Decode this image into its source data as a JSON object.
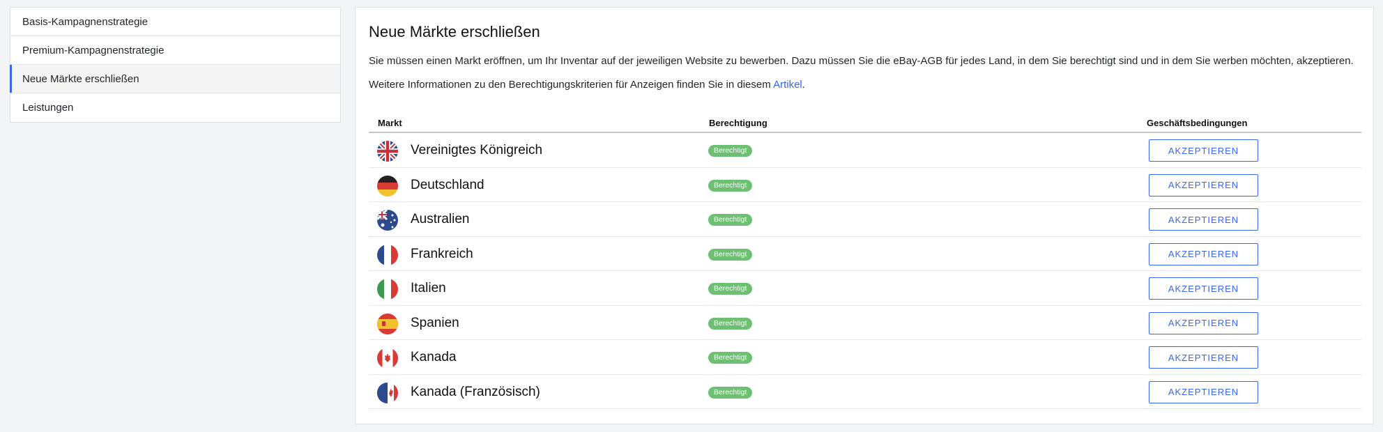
{
  "sidebar": {
    "items": [
      {
        "label": "Basis-Kampagnenstrategie"
      },
      {
        "label": "Premium-Kampagnenstrategie"
      },
      {
        "label": "Neue Märkte erschließen"
      },
      {
        "label": "Leistungen"
      }
    ]
  },
  "main": {
    "title": "Neue Märkte erschließen",
    "paragraph1": "Sie müssen einen Markt eröffnen, um Ihr Inventar auf der jeweiligen Website zu bewerben. Dazu müssen Sie die eBay-AGB für jedes Land, in dem Sie berechtigt sind und in dem Sie werben möchten, akzeptieren.",
    "paragraph2_prefix": "Weitere Informationen zu den Berechtigungskriterien für Anzeigen finden Sie in diesem ",
    "paragraph2_link": "Artikel",
    "paragraph2_suffix": "."
  },
  "table": {
    "headers": {
      "market": "Markt",
      "eligibility": "Berechtigung",
      "terms": "Geschäftsbedingungen"
    },
    "rows": [
      {
        "market": "Vereinigtes Königreich",
        "flag": "uk-flag-icon",
        "status": "Berechtigt",
        "action": "AKZEPTIEREN"
      },
      {
        "market": "Deutschland",
        "flag": "germany-flag-icon",
        "status": "Berechtigt",
        "action": "AKZEPTIEREN"
      },
      {
        "market": "Australien",
        "flag": "australia-flag-icon",
        "status": "Berechtigt",
        "action": "AKZEPTIEREN"
      },
      {
        "market": "Frankreich",
        "flag": "france-flag-icon",
        "status": "Berechtigt",
        "action": "AKZEPTIEREN"
      },
      {
        "market": "Italien",
        "flag": "italy-flag-icon",
        "status": "Berechtigt",
        "action": "AKZEPTIEREN"
      },
      {
        "market": "Spanien",
        "flag": "spain-flag-icon",
        "status": "Berechtigt",
        "action": "AKZEPTIEREN"
      },
      {
        "market": "Kanada",
        "flag": "canada-flag-icon",
        "status": "Berechtigt",
        "action": "AKZEPTIEREN"
      },
      {
        "market": "Kanada (Französisch)",
        "flag": "canada-france-flag-icon",
        "status": "Berechtigt",
        "action": "AKZEPTIEREN"
      }
    ]
  },
  "colors": {
    "accent": "#3665f3",
    "badge": "#6dbf72"
  }
}
